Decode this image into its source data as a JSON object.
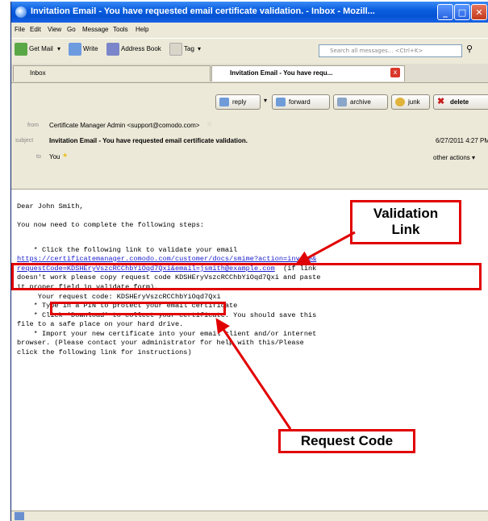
{
  "window": {
    "title": "Invitation Email - You have requested email certificate validation. - Inbox - Mozill..."
  },
  "menu": [
    "File",
    "Edit",
    "View",
    "Go",
    "Message",
    "Tools",
    "Help"
  ],
  "toolbar": {
    "get_mail": "Get Mail",
    "write": "Write",
    "address_book": "Address Book",
    "tag": "Tag",
    "search_placeholder": "Search all messages... <Ctrl+K>"
  },
  "tabs": {
    "inbox": "Inbox",
    "message": "Invitation Email - You have requ..."
  },
  "actions": {
    "reply": "reply",
    "forward": "forward",
    "archive": "archive",
    "junk": "junk",
    "delete": "delete"
  },
  "header": {
    "from_label": "from",
    "from_value": "Certificate Manager Admin <support@comodo.com>",
    "subject_label": "subject",
    "subject_value": "Invitation Email - You have requested email certificate validation.",
    "date": "6/27/2011 4:27 PM",
    "to_label": "to",
    "to_value": "You",
    "other_actions": "other actions"
  },
  "body": {
    "greeting": "Dear John Smith,",
    "intro": "You now need to complete the following steps:",
    "step1": "    * Click the following link to validate your email",
    "link_line1": "https://certificatemanager.comodo.com/customer/docs/smime?action=invite&",
    "link_line2": "requestCode=KDSHEryVszcRCChbYiOqd7Qxi&email=jsmith@example.com",
    "link_suffix": "  (if link",
    "fallback1": "doesn't work please copy request code KDSHEryVszcRCChbYiOqd7Qxi and paste",
    "fallback2": "it proper field in validate form).",
    "request_code_line": "     Your request code: KDSHEryVszcRCChbYiOqd7Qxi",
    "step2": "    * Type in a PIN to protect your email certificate",
    "step3a": "    * Click 'Download' to collect your certificate. You should save this",
    "step3b": "file to a safe place on your hard drive.",
    "step4a": "    * Import your new certificate into your email client and/or internet",
    "step4b": "browser. (Please contact your administrator for help with this/Please",
    "step4c": "click the following link for instructions)"
  },
  "annotations": {
    "validation_link_line1": "Validation",
    "validation_link_line2": "Link",
    "request_code": "Request Code",
    "color": "#e10000"
  }
}
